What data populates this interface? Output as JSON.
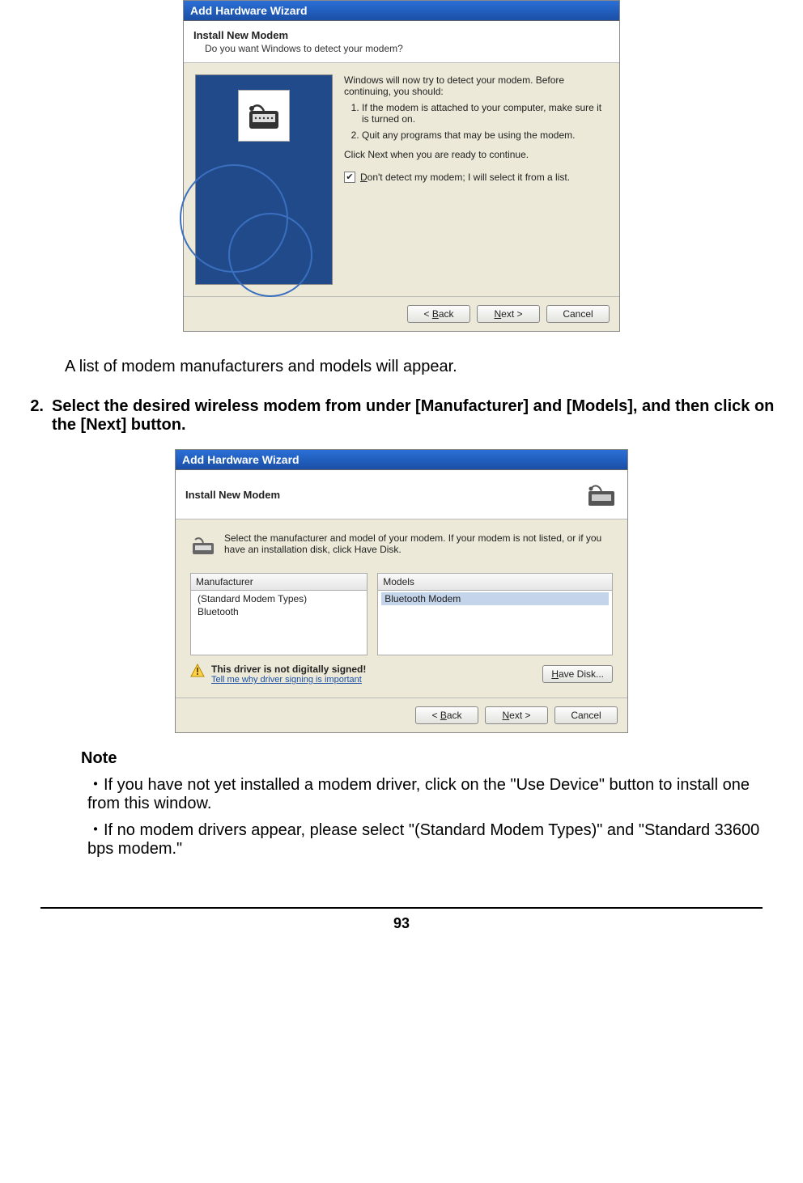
{
  "dialog1": {
    "title": "Add Hardware Wizard",
    "header_title": "Install New Modem",
    "header_sub": "Do you want Windows to detect your modem?",
    "intro": "Windows will now try to detect your modem. Before continuing, you should:",
    "steps": [
      "If the modem is attached to your computer, make sure it is turned on.",
      "Quit any programs that may be using the modem."
    ],
    "post": "Click Next when you are ready to continue.",
    "checkbox_label": "Don't detect my modem; I will select it from a list.",
    "checkbox_mnemonic": "D",
    "buttons": {
      "back": "< Back",
      "next": "Next >",
      "cancel": "Cancel"
    }
  },
  "doc": {
    "after_dialog1": "A list of modem manufacturers and models will appear.",
    "step2_num": "2.",
    "step2_text": "Select the desired wireless modem from under [Manufacturer] and [Models], and then click on the [Next] button."
  },
  "dialog2": {
    "title": "Add Hardware Wizard",
    "header_title": "Install New Modem",
    "instruction": "Select the manufacturer and model of your modem. If your modem is not listed, or if you have an installation disk, click Have Disk.",
    "manufacturer_header": "Manufacturer",
    "manufacturers": [
      "(Standard Modem Types)",
      "Bluetooth"
    ],
    "models_header": "Models",
    "models": [
      "Bluetooth Modem"
    ],
    "selected_model_index": 0,
    "warn_title": "This driver is not digitally signed!",
    "warn_link": "Tell me why driver signing is important",
    "have_disk": "Have Disk...",
    "buttons": {
      "back": "< Back",
      "next": "Next >",
      "cancel": "Cancel"
    }
  },
  "note": {
    "title": "Note",
    "items": [
      "If you have not yet installed a modem driver, click on the \"Use Device\" button to install one from this window.",
      "If no modem drivers appear, please select \"(Standard Modem Types)\" and \"Standard 33600 bps modem.\""
    ],
    "bullet": "・"
  },
  "page_number": "93"
}
